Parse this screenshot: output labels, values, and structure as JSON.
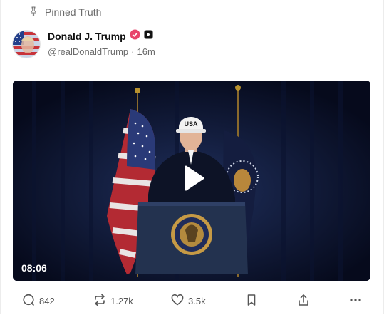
{
  "pinned": {
    "label": "Pinned Truth",
    "icon": "pin-icon"
  },
  "author": {
    "name": "Donald J. Trump",
    "handle": "@realDonaldTrump",
    "separator": "·",
    "time": "16m",
    "verified_color": "#e8436a"
  },
  "video": {
    "duration": "08:06",
    "cap_text": "USA"
  },
  "actions": {
    "replies": "842",
    "retruths": "1.27k",
    "likes": "3.5k"
  }
}
